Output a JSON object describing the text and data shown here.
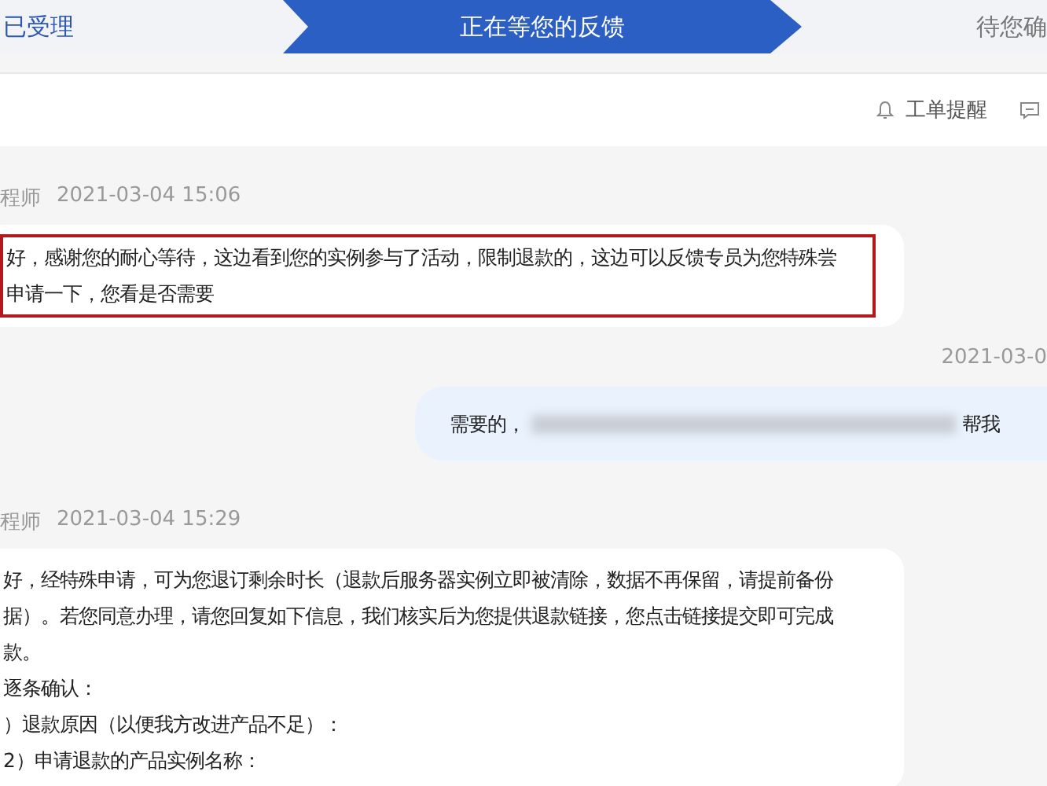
{
  "steps": [
    {
      "label": "已受理",
      "kind": "done"
    },
    {
      "label": "正在等您的反馈",
      "kind": "current"
    },
    {
      "label": "待您确",
      "kind": "pending"
    }
  ],
  "toolbar": {
    "reminder": "工单提醒"
  },
  "messages": [
    {
      "kind": "incoming",
      "sender": "程师",
      "time": "2021-03-04 15:06",
      "highlighted": true,
      "lines": [
        {
          "parts": [
            {
              "kind": "text",
              "text": "好，感谢您的耐心等待，这边看到您的实例参与了活动，限制退款的，这边可以反馈专员为您特殊尝"
            }
          ]
        },
        {
          "parts": [
            {
              "kind": "text",
              "text": "申请一下，您看是否需要"
            }
          ]
        }
      ]
    },
    {
      "kind": "outgoing",
      "time": "2021-03-0",
      "highlighted": false,
      "lines": [
        {
          "parts": [
            {
              "kind": "text",
              "text": "需要的，"
            },
            {
              "kind": "redacted"
            },
            {
              "kind": "text",
              "text": "帮我"
            }
          ]
        }
      ]
    },
    {
      "kind": "incoming",
      "sender": "程师",
      "time": "2021-03-04 15:29",
      "highlighted": false,
      "lines": [
        {
          "parts": [
            {
              "kind": "text",
              "text": "好，经特殊申请，可为您退订剩余时长（退款后服务器实例立即被清除，数据不再保留，请提前备份"
            }
          ]
        },
        {
          "parts": [
            {
              "kind": "text",
              "text": "据）。若您同意办理，请您回复如下信息，我们核实后为您提供退款链接，您点击链接提交即可完成"
            }
          ]
        },
        {
          "parts": [
            {
              "kind": "text",
              "text": "款。"
            }
          ]
        },
        {
          "parts": [
            {
              "kind": "text",
              "text": "逐条确认："
            }
          ]
        },
        {
          "parts": [
            {
              "kind": "text",
              "text": "）退款原因（以便我方改进产品不足）："
            }
          ]
        },
        {
          "parts": [
            {
              "kind": "text",
              "text": "2）申请退款的产品实例名称："
            }
          ]
        }
      ]
    }
  ]
}
